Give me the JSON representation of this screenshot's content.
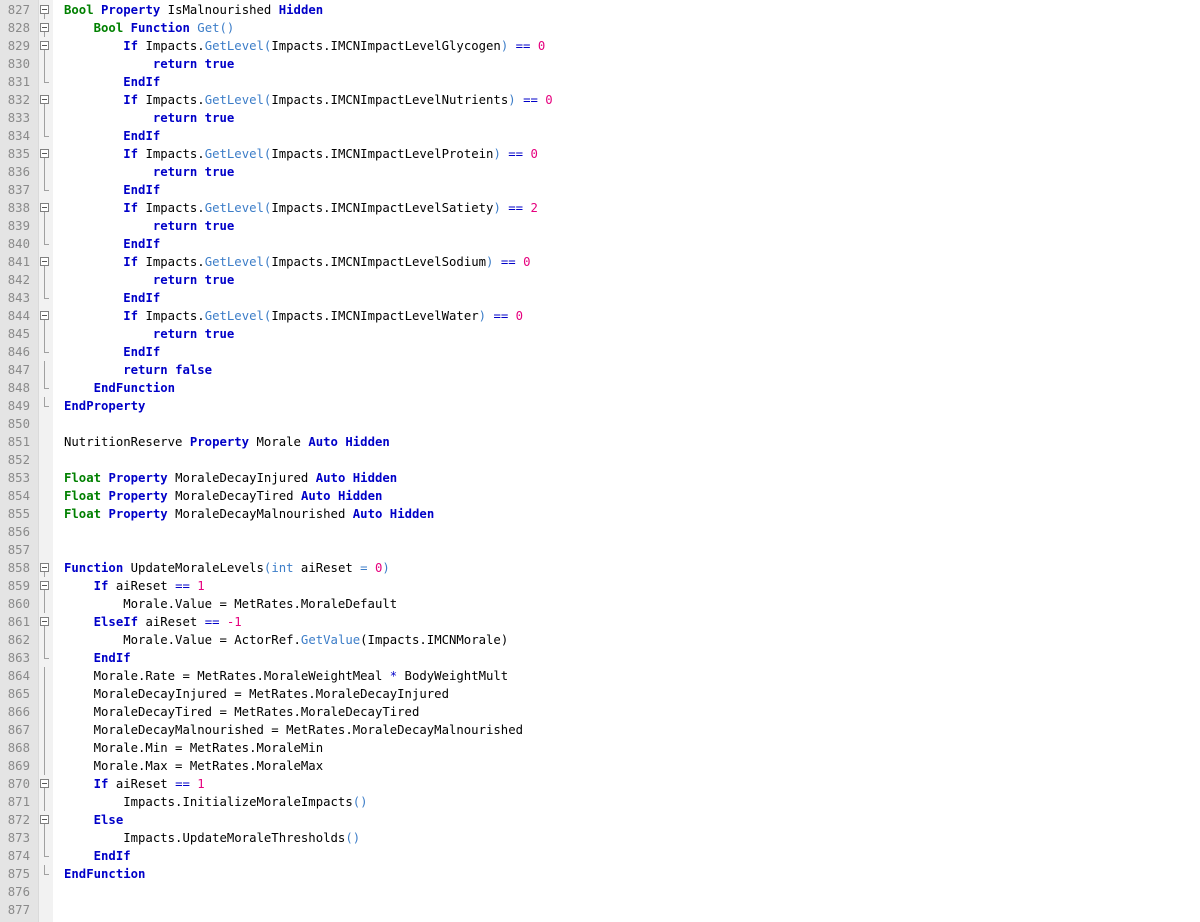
{
  "editor": {
    "language": "Papyrus",
    "colors": {
      "keyword": "#0000c8",
      "type": "#008000",
      "function_call": "#3c7dc8",
      "number": "#e6007e",
      "text": "#000000",
      "line_number": "#8a8a8a"
    },
    "lines": [
      {
        "num": "827",
        "fold": "open",
        "tokens": [
          [
            "ty",
            "Bool"
          ],
          [
            "t",
            " "
          ],
          [
            "kw",
            "Property"
          ],
          [
            "t",
            " IsMalnourished "
          ],
          [
            "kw",
            "Hidden"
          ]
        ]
      },
      {
        "num": "828",
        "fold": "open",
        "tokens": [
          [
            "t",
            "    "
          ],
          [
            "ty",
            "Bool"
          ],
          [
            "t",
            " "
          ],
          [
            "kw",
            "Function"
          ],
          [
            "t",
            " "
          ],
          [
            "fn",
            "Get"
          ],
          [
            "sym",
            "()"
          ]
        ]
      },
      {
        "num": "829",
        "fold": "open",
        "tokens": [
          [
            "t",
            "        "
          ],
          [
            "kw",
            "If"
          ],
          [
            "t",
            " Impacts."
          ],
          [
            "fn",
            "GetLevel"
          ],
          [
            "sym",
            "("
          ],
          [
            "t",
            "Impacts.IMCNImpactLevelGlycogen"
          ],
          [
            "sym",
            ")"
          ],
          [
            "t",
            " "
          ],
          [
            "op",
            "=="
          ],
          [
            "t",
            " "
          ],
          [
            "num",
            "0"
          ]
        ]
      },
      {
        "num": "830",
        "fold": "line",
        "tokens": [
          [
            "t",
            "            "
          ],
          [
            "kw",
            "return"
          ],
          [
            "t",
            " "
          ],
          [
            "kw",
            "true"
          ]
        ]
      },
      {
        "num": "831",
        "fold": "end",
        "tokens": [
          [
            "t",
            "        "
          ],
          [
            "kw",
            "EndIf"
          ]
        ]
      },
      {
        "num": "832",
        "fold": "open",
        "tokens": [
          [
            "t",
            "        "
          ],
          [
            "kw",
            "If"
          ],
          [
            "t",
            " Impacts."
          ],
          [
            "fn",
            "GetLevel"
          ],
          [
            "sym",
            "("
          ],
          [
            "t",
            "Impacts.IMCNImpactLevelNutrients"
          ],
          [
            "sym",
            ")"
          ],
          [
            "t",
            " "
          ],
          [
            "op",
            "=="
          ],
          [
            "t",
            " "
          ],
          [
            "num",
            "0"
          ]
        ]
      },
      {
        "num": "833",
        "fold": "line",
        "tokens": [
          [
            "t",
            "            "
          ],
          [
            "kw",
            "return"
          ],
          [
            "t",
            " "
          ],
          [
            "kw",
            "true"
          ]
        ]
      },
      {
        "num": "834",
        "fold": "end",
        "tokens": [
          [
            "t",
            "        "
          ],
          [
            "kw",
            "EndIf"
          ]
        ]
      },
      {
        "num": "835",
        "fold": "open",
        "tokens": [
          [
            "t",
            "        "
          ],
          [
            "kw",
            "If"
          ],
          [
            "t",
            " Impacts."
          ],
          [
            "fn",
            "GetLevel"
          ],
          [
            "sym",
            "("
          ],
          [
            "t",
            "Impacts.IMCNImpactLevelProtein"
          ],
          [
            "sym",
            ")"
          ],
          [
            "t",
            " "
          ],
          [
            "op",
            "=="
          ],
          [
            "t",
            " "
          ],
          [
            "num",
            "0"
          ]
        ]
      },
      {
        "num": "836",
        "fold": "line",
        "tokens": [
          [
            "t",
            "            "
          ],
          [
            "kw",
            "return"
          ],
          [
            "t",
            " "
          ],
          [
            "kw",
            "true"
          ]
        ]
      },
      {
        "num": "837",
        "fold": "end",
        "tokens": [
          [
            "t",
            "        "
          ],
          [
            "kw",
            "EndIf"
          ]
        ]
      },
      {
        "num": "838",
        "fold": "open",
        "tokens": [
          [
            "t",
            "        "
          ],
          [
            "kw",
            "If"
          ],
          [
            "t",
            " Impacts."
          ],
          [
            "fn",
            "GetLevel"
          ],
          [
            "sym",
            "("
          ],
          [
            "t",
            "Impacts.IMCNImpactLevelSatiety"
          ],
          [
            "sym",
            ")"
          ],
          [
            "t",
            " "
          ],
          [
            "op",
            "=="
          ],
          [
            "t",
            " "
          ],
          [
            "num",
            "2"
          ]
        ]
      },
      {
        "num": "839",
        "fold": "line",
        "tokens": [
          [
            "t",
            "            "
          ],
          [
            "kw",
            "return"
          ],
          [
            "t",
            " "
          ],
          [
            "kw",
            "true"
          ]
        ]
      },
      {
        "num": "840",
        "fold": "end",
        "tokens": [
          [
            "t",
            "        "
          ],
          [
            "kw",
            "EndIf"
          ]
        ]
      },
      {
        "num": "841",
        "fold": "open",
        "tokens": [
          [
            "t",
            "        "
          ],
          [
            "kw",
            "If"
          ],
          [
            "t",
            " Impacts."
          ],
          [
            "fn",
            "GetLevel"
          ],
          [
            "sym",
            "("
          ],
          [
            "t",
            "Impacts.IMCNImpactLevelSodium"
          ],
          [
            "sym",
            ")"
          ],
          [
            "t",
            " "
          ],
          [
            "op",
            "=="
          ],
          [
            "t",
            " "
          ],
          [
            "num",
            "0"
          ]
        ]
      },
      {
        "num": "842",
        "fold": "line",
        "tokens": [
          [
            "t",
            "            "
          ],
          [
            "kw",
            "return"
          ],
          [
            "t",
            " "
          ],
          [
            "kw",
            "true"
          ]
        ]
      },
      {
        "num": "843",
        "fold": "end",
        "tokens": [
          [
            "t",
            "        "
          ],
          [
            "kw",
            "EndIf"
          ]
        ]
      },
      {
        "num": "844",
        "fold": "open",
        "tokens": [
          [
            "t",
            "        "
          ],
          [
            "kw",
            "If"
          ],
          [
            "t",
            " Impacts."
          ],
          [
            "fn",
            "GetLevel"
          ],
          [
            "sym",
            "("
          ],
          [
            "t",
            "Impacts.IMCNImpactLevelWater"
          ],
          [
            "sym",
            ")"
          ],
          [
            "t",
            " "
          ],
          [
            "op",
            "=="
          ],
          [
            "t",
            " "
          ],
          [
            "num",
            "0"
          ]
        ]
      },
      {
        "num": "845",
        "fold": "line",
        "tokens": [
          [
            "t",
            "            "
          ],
          [
            "kw",
            "return"
          ],
          [
            "t",
            " "
          ],
          [
            "kw",
            "true"
          ]
        ]
      },
      {
        "num": "846",
        "fold": "end",
        "tokens": [
          [
            "t",
            "        "
          ],
          [
            "kw",
            "EndIf"
          ]
        ]
      },
      {
        "num": "847",
        "fold": "line",
        "tokens": [
          [
            "t",
            "        "
          ],
          [
            "kw",
            "return"
          ],
          [
            "t",
            " "
          ],
          [
            "kw",
            "false"
          ]
        ]
      },
      {
        "num": "848",
        "fold": "end",
        "tokens": [
          [
            "t",
            "    "
          ],
          [
            "kw",
            "EndFunction"
          ]
        ]
      },
      {
        "num": "849",
        "fold": "end",
        "tokens": [
          [
            "kw",
            "EndProperty"
          ]
        ]
      },
      {
        "num": "850",
        "fold": "none",
        "tokens": []
      },
      {
        "num": "851",
        "fold": "none",
        "tokens": [
          [
            "t",
            "NutritionReserve "
          ],
          [
            "kw",
            "Property"
          ],
          [
            "t",
            " Morale "
          ],
          [
            "kw",
            "Auto"
          ],
          [
            "t",
            " "
          ],
          [
            "kw",
            "Hidden"
          ]
        ]
      },
      {
        "num": "852",
        "fold": "none",
        "tokens": []
      },
      {
        "num": "853",
        "fold": "none",
        "tokens": [
          [
            "ty",
            "Float"
          ],
          [
            "t",
            " "
          ],
          [
            "kw",
            "Property"
          ],
          [
            "t",
            " MoraleDecayInjured "
          ],
          [
            "kw",
            "Auto"
          ],
          [
            "t",
            " "
          ],
          [
            "kw",
            "Hidden"
          ]
        ]
      },
      {
        "num": "854",
        "fold": "none",
        "tokens": [
          [
            "ty",
            "Float"
          ],
          [
            "t",
            " "
          ],
          [
            "kw",
            "Property"
          ],
          [
            "t",
            " MoraleDecayTired "
          ],
          [
            "kw",
            "Auto"
          ],
          [
            "t",
            " "
          ],
          [
            "kw",
            "Hidden"
          ]
        ]
      },
      {
        "num": "855",
        "fold": "none",
        "tokens": [
          [
            "ty",
            "Float"
          ],
          [
            "t",
            " "
          ],
          [
            "kw",
            "Property"
          ],
          [
            "t",
            " MoraleDecayMalnourished "
          ],
          [
            "kw",
            "Auto"
          ],
          [
            "t",
            " "
          ],
          [
            "kw",
            "Hidden"
          ]
        ]
      },
      {
        "num": "856",
        "fold": "none",
        "tokens": []
      },
      {
        "num": "857",
        "fold": "none",
        "tokens": []
      },
      {
        "num": "858",
        "fold": "open",
        "tokens": [
          [
            "kw",
            "Function"
          ],
          [
            "t",
            " UpdateMoraleLevels"
          ],
          [
            "sym",
            "("
          ],
          [
            "fn",
            "int"
          ],
          [
            "t",
            " aiReset "
          ],
          [
            "sym",
            "="
          ],
          [
            "t",
            " "
          ],
          [
            "num",
            "0"
          ],
          [
            "sym",
            ")"
          ]
        ]
      },
      {
        "num": "859",
        "fold": "open",
        "tokens": [
          [
            "t",
            "    "
          ],
          [
            "kw",
            "If"
          ],
          [
            "t",
            " aiReset "
          ],
          [
            "op",
            "=="
          ],
          [
            "t",
            " "
          ],
          [
            "num",
            "1"
          ]
        ]
      },
      {
        "num": "860",
        "fold": "line",
        "tokens": [
          [
            "t",
            "        Morale.Value = MetRates.MoraleDefault"
          ]
        ]
      },
      {
        "num": "861",
        "fold": "open",
        "tokens": [
          [
            "t",
            "    "
          ],
          [
            "kw",
            "ElseIf"
          ],
          [
            "t",
            " aiReset "
          ],
          [
            "op",
            "=="
          ],
          [
            "t",
            " "
          ],
          [
            "num",
            "-1"
          ]
        ]
      },
      {
        "num": "862",
        "fold": "line",
        "tokens": [
          [
            "t",
            "        Morale.Value = ActorRef."
          ],
          [
            "fn",
            "GetValue"
          ],
          [
            "t",
            "(Impacts.IMCNMorale)"
          ]
        ]
      },
      {
        "num": "863",
        "fold": "end",
        "tokens": [
          [
            "t",
            "    "
          ],
          [
            "kw",
            "EndIf"
          ]
        ]
      },
      {
        "num": "864",
        "fold": "line",
        "tokens": [
          [
            "t",
            "    Morale.Rate = MetRates.MoraleWeightMeal "
          ],
          [
            "op",
            "*"
          ],
          [
            "t",
            " BodyWeightMult"
          ]
        ]
      },
      {
        "num": "865",
        "fold": "line",
        "tokens": [
          [
            "t",
            "    MoraleDecayInjured = MetRates.MoraleDecayInjured"
          ]
        ]
      },
      {
        "num": "866",
        "fold": "line",
        "tokens": [
          [
            "t",
            "    MoraleDecayTired = MetRates.MoraleDecayTired"
          ]
        ]
      },
      {
        "num": "867",
        "fold": "line",
        "tokens": [
          [
            "t",
            "    MoraleDecayMalnourished = MetRates.MoraleDecayMalnourished"
          ]
        ]
      },
      {
        "num": "868",
        "fold": "line",
        "tokens": [
          [
            "t",
            "    Morale.Min = MetRates.MoraleMin"
          ]
        ]
      },
      {
        "num": "869",
        "fold": "line",
        "tokens": [
          [
            "t",
            "    Morale.Max = MetRates.MoraleMax"
          ]
        ]
      },
      {
        "num": "870",
        "fold": "open",
        "tokens": [
          [
            "t",
            "    "
          ],
          [
            "kw",
            "If"
          ],
          [
            "t",
            " aiReset "
          ],
          [
            "op",
            "=="
          ],
          [
            "t",
            " "
          ],
          [
            "num",
            "1"
          ]
        ]
      },
      {
        "num": "871",
        "fold": "line",
        "tokens": [
          [
            "t",
            "        Impacts.InitializeMoraleImpacts"
          ],
          [
            "sym",
            "()"
          ]
        ]
      },
      {
        "num": "872",
        "fold": "open",
        "tokens": [
          [
            "t",
            "    "
          ],
          [
            "kw",
            "Else"
          ]
        ]
      },
      {
        "num": "873",
        "fold": "line",
        "tokens": [
          [
            "t",
            "        Impacts.UpdateMoraleThresholds"
          ],
          [
            "sym",
            "()"
          ]
        ]
      },
      {
        "num": "874",
        "fold": "end",
        "tokens": [
          [
            "t",
            "    "
          ],
          [
            "kw",
            "EndIf"
          ]
        ]
      },
      {
        "num": "875",
        "fold": "end",
        "tokens": [
          [
            "kw",
            "EndFunction"
          ]
        ]
      },
      {
        "num": "876",
        "fold": "none",
        "tokens": []
      },
      {
        "num": "877",
        "fold": "none",
        "tokens": []
      }
    ]
  }
}
